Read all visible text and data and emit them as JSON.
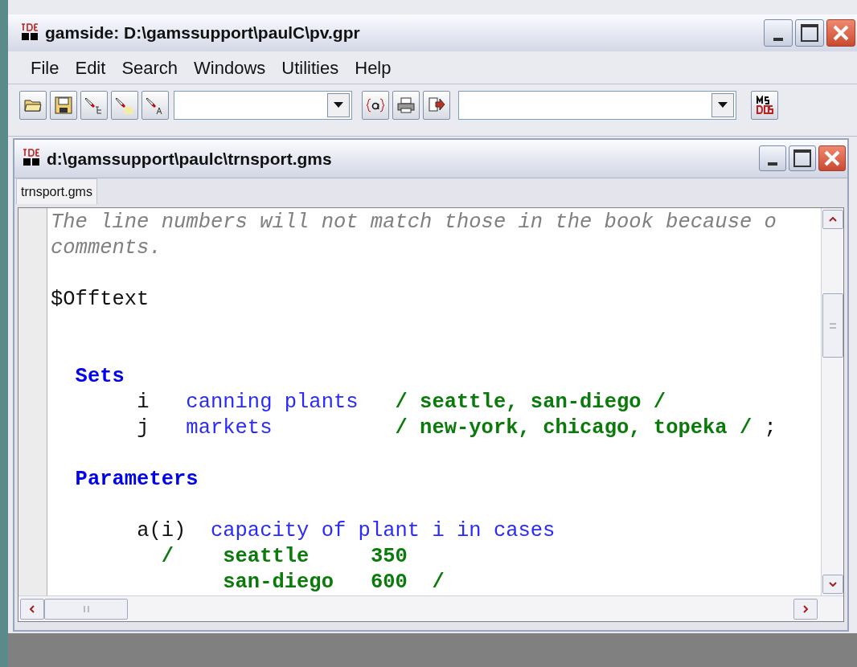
{
  "window": {
    "title": "gamside: D:\\gamssupport\\paulC\\pv.gpr"
  },
  "menu": [
    "File",
    "Edit",
    "Search",
    "Windows",
    "Utilities",
    "Help"
  ],
  "document": {
    "title": "d:\\gamssupport\\paulc\\trnsport.gms",
    "tabs": [
      {
        "label": "trnsport.gms",
        "selected": true
      }
    ],
    "lines": [
      {
        "kind": "code",
        "segments": [
          {
            "kind": "comment",
            "text": "The line numbers will not match those in the book because o"
          }
        ]
      },
      {
        "kind": "code",
        "segments": [
          {
            "kind": "comment",
            "text": "comments."
          }
        ]
      },
      {
        "kind": "blank"
      },
      {
        "kind": "code",
        "segments": [
          {
            "kind": "plain",
            "text": "$Offtext"
          }
        ]
      },
      {
        "kind": "blank"
      },
      {
        "kind": "blank"
      },
      {
        "kind": "code",
        "segments": [
          {
            "kind": "keyword",
            "text": "  Sets"
          }
        ]
      },
      {
        "kind": "code",
        "segments": [
          {
            "kind": "plain",
            "text": "       i   "
          },
          {
            "kind": "text",
            "text": "canning plants   "
          },
          {
            "kind": "data",
            "text": "/ seattle, san-diego /"
          }
        ]
      },
      {
        "kind": "code",
        "segments": [
          {
            "kind": "plain",
            "text": "       j   "
          },
          {
            "kind": "text",
            "text": "markets          "
          },
          {
            "kind": "data",
            "text": "/ new-york, chicago, topeka / "
          },
          {
            "kind": "plain",
            "text": ";"
          }
        ]
      },
      {
        "kind": "blank"
      },
      {
        "kind": "code",
        "segments": [
          {
            "kind": "keyword",
            "text": "  Parameters"
          }
        ]
      },
      {
        "kind": "blank"
      },
      {
        "kind": "code",
        "segments": [
          {
            "kind": "plain",
            "text": "       a(i)  "
          },
          {
            "kind": "text",
            "text": "capacity of plant i in cases"
          }
        ]
      },
      {
        "kind": "code",
        "segments": [
          {
            "kind": "data",
            "text": "         /    seattle     350"
          }
        ]
      },
      {
        "kind": "code",
        "segments": [
          {
            "kind": "data",
            "text": "              san-diego   600  /"
          }
        ]
      }
    ]
  }
}
